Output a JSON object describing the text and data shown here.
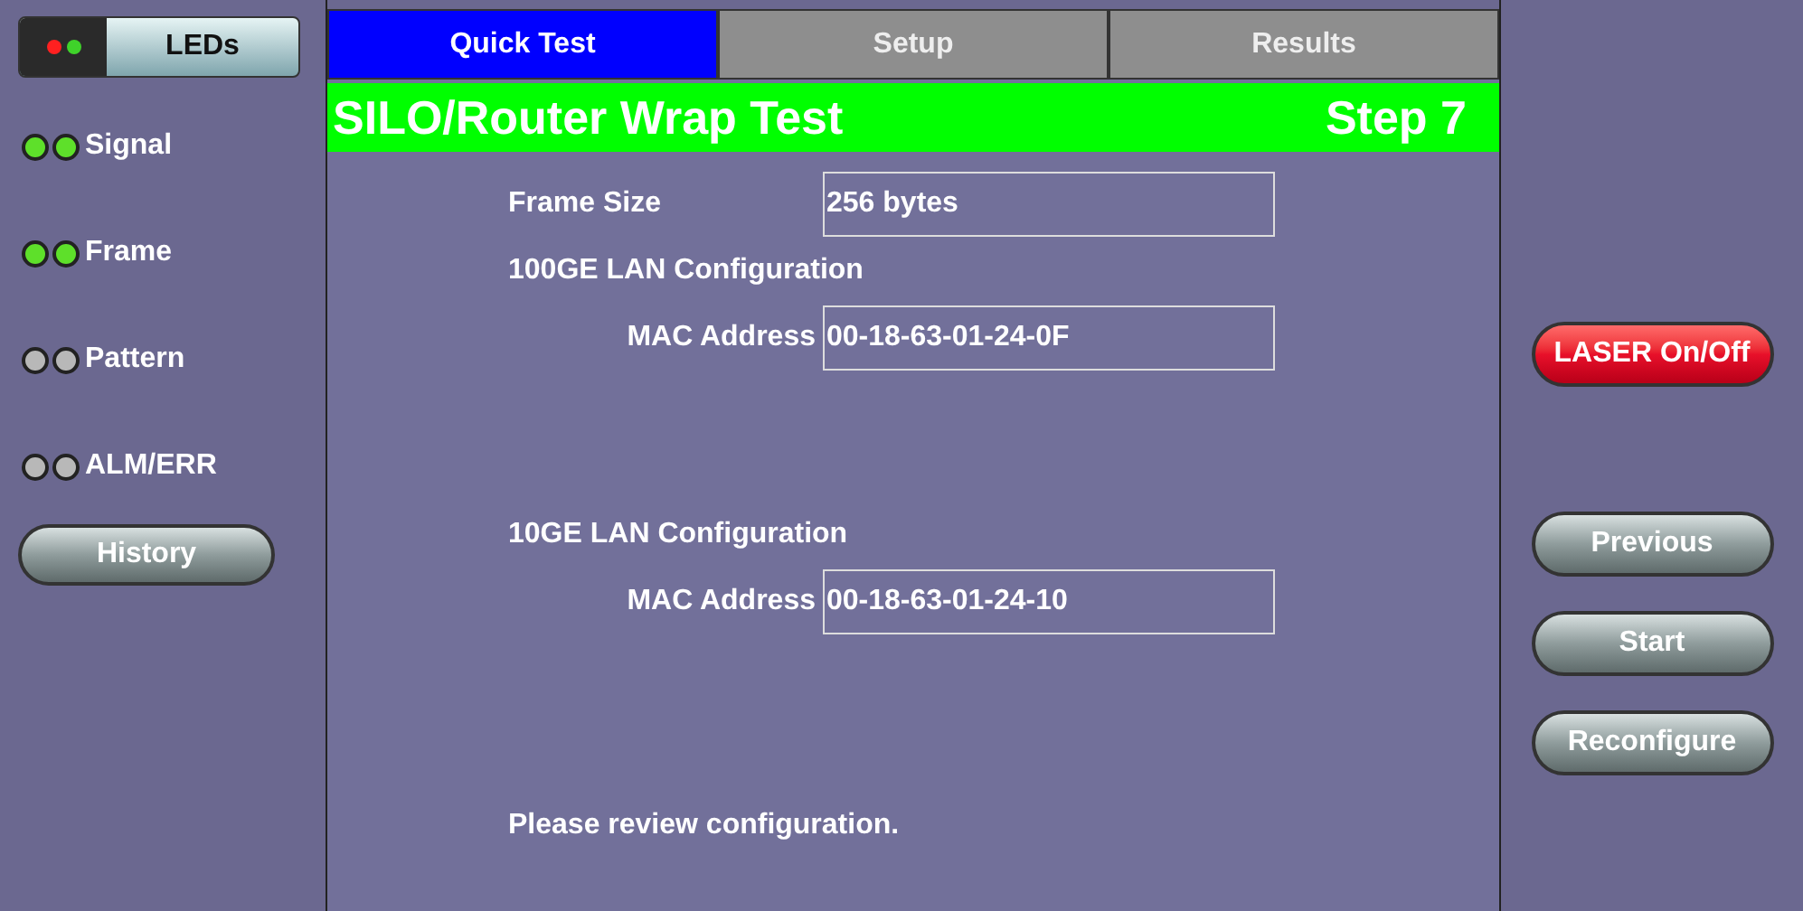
{
  "leds_button": {
    "label": "LEDs",
    "dots": [
      {
        "color": "#ff2020"
      },
      {
        "color": "#3fd22a"
      }
    ]
  },
  "leds": [
    {
      "label": "Signal",
      "on": [
        true,
        true
      ]
    },
    {
      "label": "Frame",
      "on": [
        true,
        true
      ]
    },
    {
      "label": "Pattern",
      "on": [
        false,
        false
      ]
    },
    {
      "label": "ALM/ERR",
      "on": [
        false,
        false
      ]
    }
  ],
  "history_button": "History",
  "tabs": [
    {
      "label": "Quick Test",
      "selected": true
    },
    {
      "label": "Setup",
      "selected": false
    },
    {
      "label": "Results",
      "selected": false
    }
  ],
  "title_bar": {
    "title": "SILO/Router Wrap Test",
    "step": "Step 7"
  },
  "frame_size": {
    "label": "Frame Size",
    "value": "256 bytes"
  },
  "sections": [
    {
      "heading": "100GE LAN Configuration",
      "label": "MAC Address",
      "value": "00-18-63-01-24-0F"
    },
    {
      "heading": "10GE LAN Configuration",
      "label": "MAC Address",
      "value": "00-18-63-01-24-10"
    }
  ],
  "message": "Please review configuration.",
  "side_buttons": [
    {
      "label": "LASER On/Off",
      "kind": "alert"
    },
    {
      "label": "Previous",
      "kind": "normal"
    },
    {
      "label": "Start",
      "kind": "normal"
    },
    {
      "label": "Reconfigure",
      "kind": "normal"
    }
  ]
}
